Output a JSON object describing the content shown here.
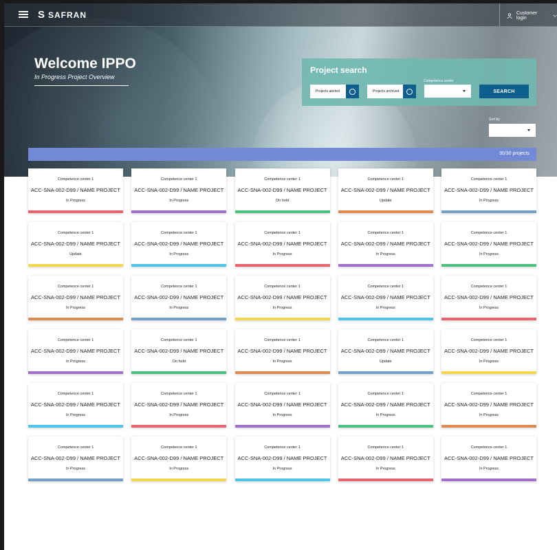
{
  "header": {
    "logo": "SAFRAN",
    "user_label": "Customer login"
  },
  "hero": {
    "title": "Welcome IPPO",
    "subtitle": "In Progress Project Overview"
  },
  "search": {
    "title": "Project search",
    "projects_alerted": "Projects alerted",
    "projects_archived": "Projects archived",
    "competence_center_label": "Competence center",
    "search_button": "SEARCH"
  },
  "sort": {
    "label": "Sort by"
  },
  "results": {
    "count": "30/30 projects"
  },
  "colors": {
    "red": "#e8656e",
    "purple": "#a26fce",
    "green": "#4cc07f",
    "orange": "#dc8b55",
    "blue": "#74a0c8",
    "yellow": "#f3d650",
    "cyan": "#4dc4e8"
  },
  "cards": [
    {
      "center": "Competence center 1",
      "name": "ACC-SNA-002-D99 / NAME PROJECT",
      "status": "In Progress",
      "color": "red"
    },
    {
      "center": "Competence center 1",
      "name": "ACC-SNA-002-D99 / NAME PROJECT",
      "status": "In Progress",
      "color": "purple"
    },
    {
      "center": "Competence center 1",
      "name": "ACC-SNA-002-D99 / NAME PROJECT",
      "status": "On hold",
      "color": "green"
    },
    {
      "center": "Competence center 1",
      "name": "ACC-SNA-002-D99 / NAME PROJECT",
      "status": "Update",
      "color": "orange"
    },
    {
      "center": "Competence center 1",
      "name": "ACC-SNA-002-D99 / NAME PROJECT",
      "status": "In Progress",
      "color": "blue"
    },
    {
      "center": "Competence center 1",
      "name": "ACC-SNA-002-D99 / NAME PROJECT",
      "status": "Update",
      "color": "yellow"
    },
    {
      "center": "Competence center 1",
      "name": "ACC-SNA-002-D99 / NAME PROJECT",
      "status": "In Progress",
      "color": "cyan"
    },
    {
      "center": "Competence center 1",
      "name": "ACC-SNA-002-D99 / NAME PROJECT",
      "status": "In Progress",
      "color": "red"
    },
    {
      "center": "Competence center 1",
      "name": "ACC-SNA-002-D99 / NAME PROJECT",
      "status": "In Progress",
      "color": "purple"
    },
    {
      "center": "Competence center 1",
      "name": "ACC-SNA-002-D99 / NAME PROJECT",
      "status": "In Progress",
      "color": "green"
    },
    {
      "center": "Competence center 1",
      "name": "ACC-SNA-002-D99 / NAME PROJECT",
      "status": "In Progress",
      "color": "orange"
    },
    {
      "center": "Competence center 1",
      "name": "ACC-SNA-002-D99 / NAME PROJECT",
      "status": "In Progress",
      "color": "blue"
    },
    {
      "center": "Competence center 1",
      "name": "ACC-SNA-002-D99 / NAME PROJECT",
      "status": "In Progress",
      "color": "yellow"
    },
    {
      "center": "Competence center 1",
      "name": "ACC-SNA-002-D99 / NAME PROJECT",
      "status": "In Progress",
      "color": "cyan"
    },
    {
      "center": "Competence center 1",
      "name": "ACC-SNA-002-D99 / NAME PROJECT",
      "status": "In Progress",
      "color": "red"
    },
    {
      "center": "Competence center 1",
      "name": "ACC-SNA-002-D99 / NAME PROJECT",
      "status": "In Progress",
      "color": "purple"
    },
    {
      "center": "Competence center 1",
      "name": "ACC-SNA-002-D99 / NAME PROJECT",
      "status": "On hold",
      "color": "green"
    },
    {
      "center": "Competence center 1",
      "name": "ACC-SNA-002-D99 / NAME PROJECT",
      "status": "In Progress",
      "color": "orange"
    },
    {
      "center": "Competence center 1",
      "name": "ACC-SNA-002-D99 / NAME PROJECT",
      "status": "Update",
      "color": "blue"
    },
    {
      "center": "Competence center 1",
      "name": "ACC-SNA-002-D99 / NAME PROJECT",
      "status": "In Progress",
      "color": "yellow"
    },
    {
      "center": "Competence center 1",
      "name": "ACC-SNA-002-D99 / NAME PROJECT",
      "status": "In Progress",
      "color": "cyan"
    },
    {
      "center": "Competence center 1",
      "name": "ACC-SNA-002-D99 / NAME PROJECT",
      "status": "In Progress",
      "color": "red"
    },
    {
      "center": "Competence center 1",
      "name": "ACC-SNA-002-D99 / NAME PROJECT",
      "status": "In Progress",
      "color": "purple"
    },
    {
      "center": "Competence center 1",
      "name": "ACC-SNA-002-D99 / NAME PROJECT",
      "status": "In Progress",
      "color": "green"
    },
    {
      "center": "Competence center 1",
      "name": "ACC-SNA-002-D99 / NAME PROJECT",
      "status": "In Progress",
      "color": "orange"
    },
    {
      "center": "Competence center 1",
      "name": "ACC-SNA-002-D99 / NAME PROJECT",
      "status": "In Progress",
      "color": "blue"
    },
    {
      "center": "Competence center 1",
      "name": "ACC-SNA-002-D99 / NAME PROJECT",
      "status": "In Progress",
      "color": "yellow"
    },
    {
      "center": "Competence center 1",
      "name": "ACC-SNA-002-D99 / NAME PROJECT",
      "status": "In Progress",
      "color": "cyan"
    },
    {
      "center": "Competence center 1",
      "name": "ACC-SNA-002-D99 / NAME PROJECT",
      "status": "In Progress",
      "color": "red"
    },
    {
      "center": "Competence center 1",
      "name": "ACC-SNA-002-D99 / NAME PROJECT",
      "status": "In Progress",
      "color": "purple"
    }
  ]
}
